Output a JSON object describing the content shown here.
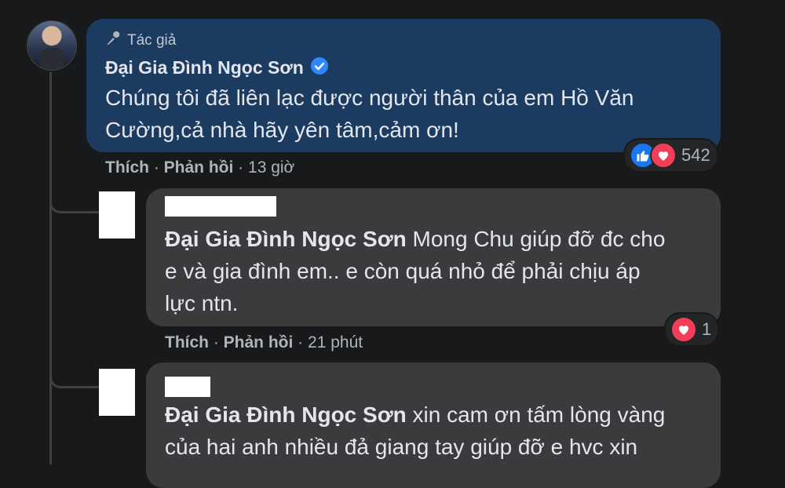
{
  "comments": [
    {
      "badge": "Tác giả",
      "name": "Đại Gia Đình Ngọc Sơn",
      "verified": true,
      "text_line1": "Chúng tôi đã liên lạc được người thân của em Hồ Văn",
      "text_line2": "Cường,cả nhà hãy yên tâm,cảm ơn!",
      "like_label": "Thích",
      "reply_label": "Phản hồi",
      "time": "13 giờ",
      "reaction_count": "542",
      "reactions": [
        "like-icon",
        "love-icon"
      ]
    },
    {
      "mention": "Đại Gia Đình Ngọc Sơn",
      "text_line1": " Mong Chu giúp đỡ đc cho",
      "text_line2": "e và gia đình em.. e còn quá nhỏ để phải chịu áp",
      "text_line3": "lực ntn.",
      "like_label": "Thích",
      "reply_label": "Phản hồi",
      "time": "21 phút",
      "reaction_count": "1",
      "reactions": [
        "love-icon"
      ]
    },
    {
      "mention": "Đại Gia Đình Ngọc Sơn",
      "text_line1": " xin cam ơn tấm lòng vàng",
      "text_line2": "của hai anh nhiều đả giang tay giúp đỡ e hvc xin"
    }
  ],
  "separator": " · ",
  "colors": {
    "background": "#18191a",
    "author_bubble": "#1c3b61",
    "reply_bubble": "#3a3b3c",
    "like_blue": "#1877f2",
    "love_red": "#f33e58"
  }
}
